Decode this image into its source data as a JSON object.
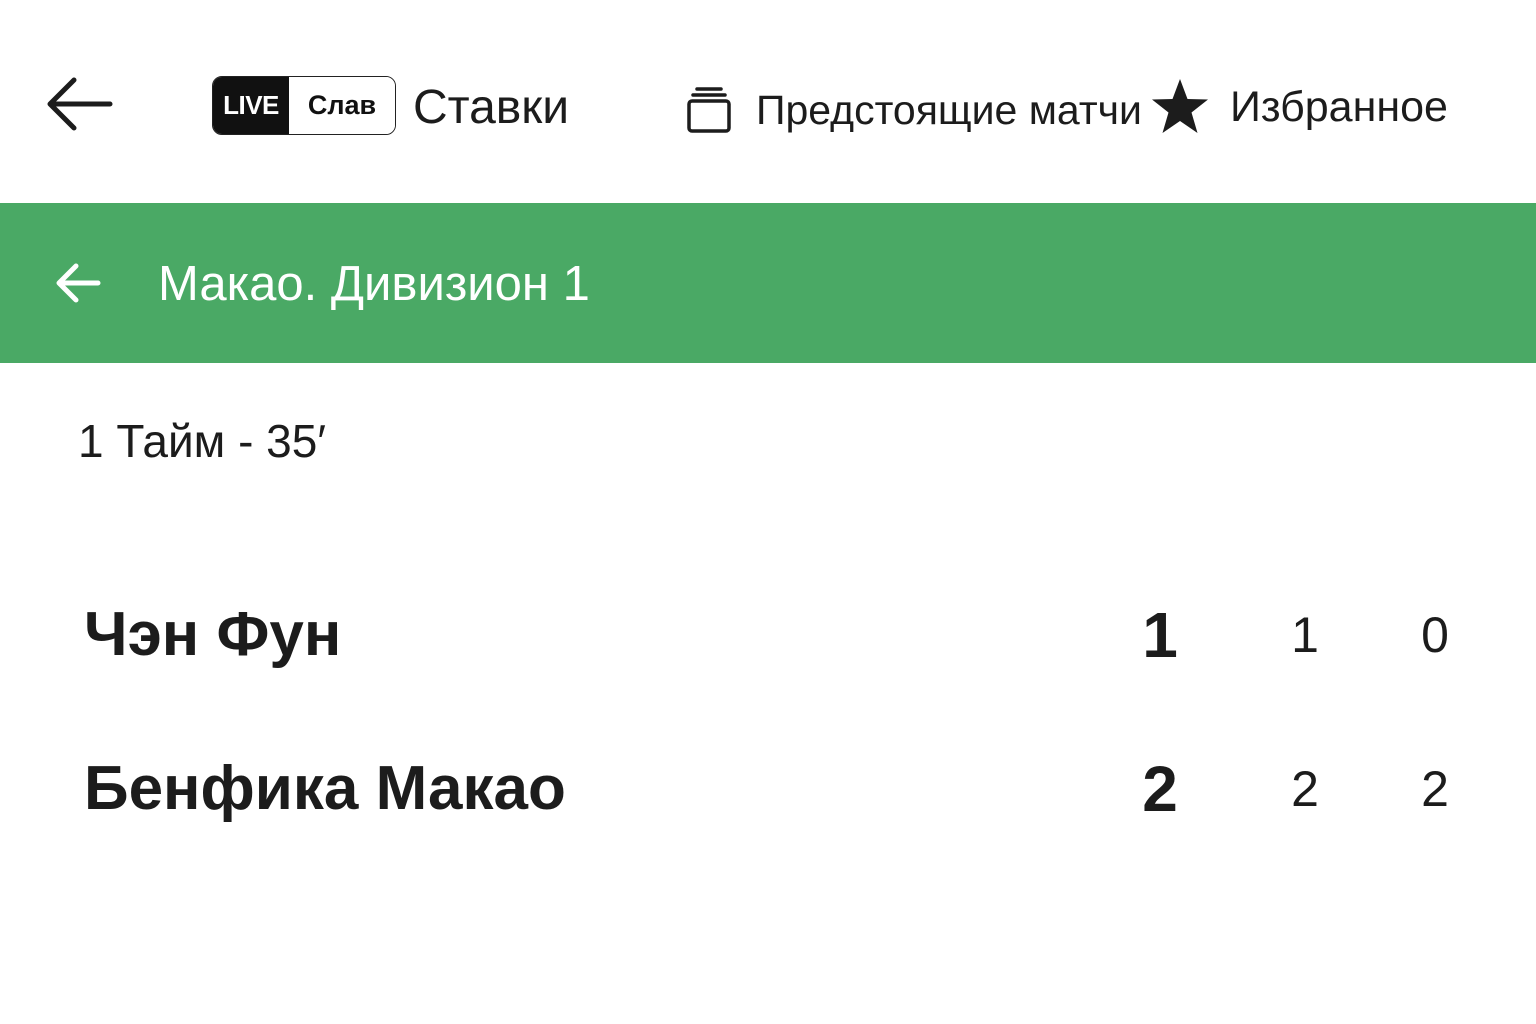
{
  "header": {
    "back_icon": "arrow-left-icon",
    "live_badge": {
      "live_text": "LIVE",
      "slav_text": "Слав"
    },
    "stavki_label": "Ставки",
    "upcoming": {
      "icon": "cards-stack-icon",
      "label": "Предстоящие матчи"
    },
    "favorites": {
      "icon": "star-icon",
      "label": "Избранное"
    }
  },
  "league": {
    "back_icon": "arrow-left-icon",
    "title": "Макао. Дивизион 1",
    "color": "#4aa965"
  },
  "match": {
    "period": "1 Тайм - 35′",
    "teams": [
      {
        "name": "Чэн Фун",
        "score_total": "1",
        "score_h1": "1",
        "score_h2": "0"
      },
      {
        "name": "Бенфика Макао",
        "score_total": "2",
        "score_h1": "2",
        "score_h2": "2"
      }
    ]
  }
}
